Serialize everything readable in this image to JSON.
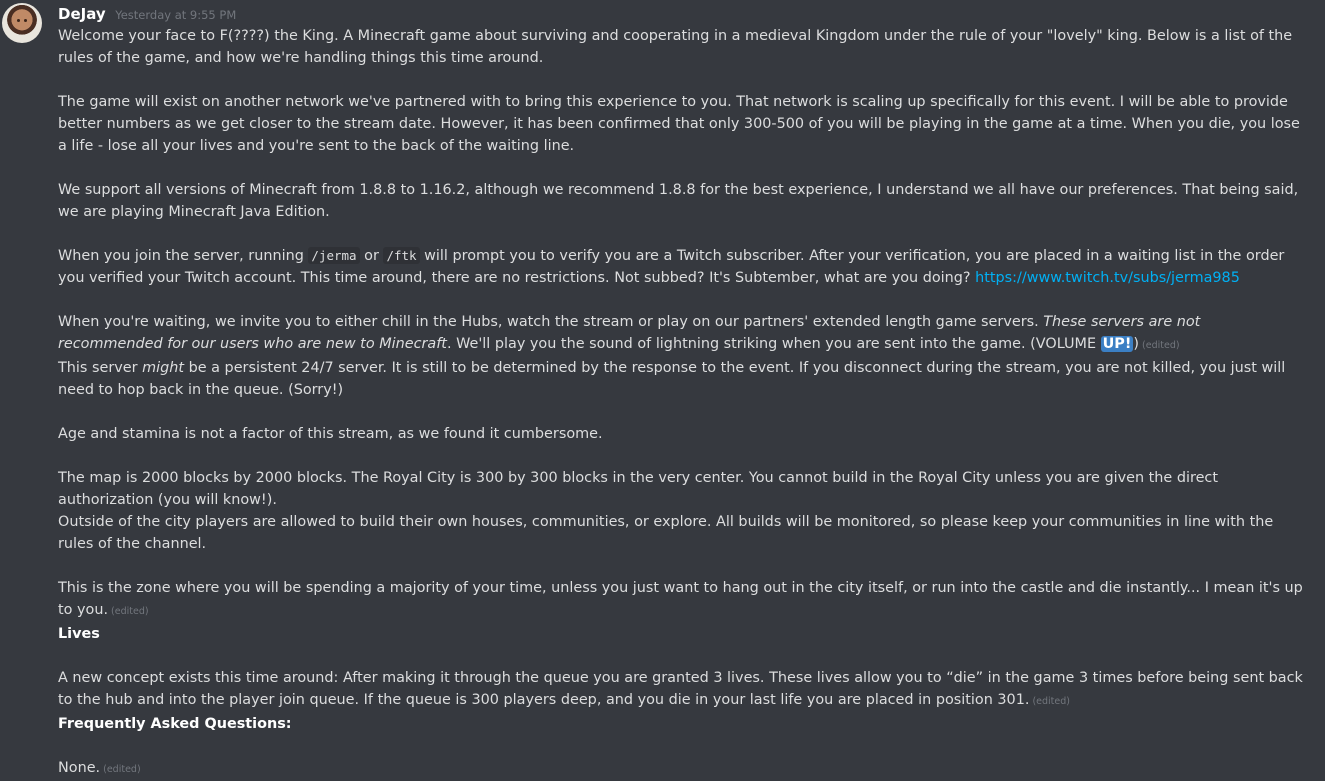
{
  "message": {
    "username": "DeJay",
    "timestamp": "Yesterday at 9:55 PM",
    "p1": "Welcome your face to F(????) the King. A Minecraft game about surviving and cooperating in a medieval Kingdom under the rule of your \"lovely\" king. Below is a list of the rules of the game, and how we're handling things this time around.",
    "p2": "The game will exist on another network we've partnered with to bring this experience to you. That network is scaling up specifically for this event. I will be able to provide better numbers as we get closer to the stream date. However, it has been confirmed that only 300-500 of you will be playing in the game at a time. When you die, you lose a life - lose all your lives and you're sent to the back of the waiting line.",
    "p3": "We support all versions of Minecraft from 1.8.8 to 1.16.2, although we recommend 1.8.8 for the best experience, I understand we all have our preferences. That being said, we are playing Minecraft Java Edition.",
    "p4_a": "When you join the server, running ",
    "p4_cmd1": "/jerma",
    "p4_b": " or ",
    "p4_cmd2": "/ftk",
    "p4_c": " will prompt you to verify you are a Twitch subscriber. After your verification, you are placed in a waiting list in the order you verified your Twitch account. This time around, there are no restrictions. Not subbed? It's Subtember, what are you doing? ",
    "p4_link": "https://www.twitch.tv/subs/jerma985",
    "p5_a": "When you're waiting, we invite you to either chill in the Hubs, watch the stream or play on our partners' extended length game servers. ",
    "p5_italic": "These servers are not recommended for our users who are new to Minecraft",
    "p5_b": ". We'll play you the sound of lightning striking when you are sent into the game. (VOLUME ",
    "p5_highlight": "UP!",
    "p5_c": ")",
    "p6_a": "This server ",
    "p6_italic": "might",
    "p6_b": " be a persistent 24/7 server. It is still to be determined by the response to the event. If you disconnect during the stream, you are not killed, you just will need to hop back in the queue. (Sorry!)",
    "p7": "Age and stamina is not a factor of this stream, as we found it cumbersome.",
    "p8": "The map is 2000 blocks by 2000 blocks. The Royal City is 300 by 300 blocks in the very center. You cannot build in the Royal City unless you are given the direct authorization (you will know!).",
    "p9": "Outside of the city players are allowed to build their own houses, communities, or explore. All builds will be monitored, so please keep your communities in line with the rules of the channel.",
    "p10": "This is the zone where you will be spending a majority of your time, unless you just want to hang out in the city itself, or run into the castle and die instantly... I mean it's up to you.",
    "lives_heading": "Lives",
    "p11": "A new concept exists this time around: After making it through the queue you are granted 3 lives. These lives allow you to “die” in the game 3 times before being sent back to the hub and into the player join queue. If the queue is 300 players deep, and you die in your last life you are placed in position 301.",
    "faq_heading": "Frequently Asked Questions:",
    "p12": "None.",
    "edited_label": "(edited)"
  }
}
